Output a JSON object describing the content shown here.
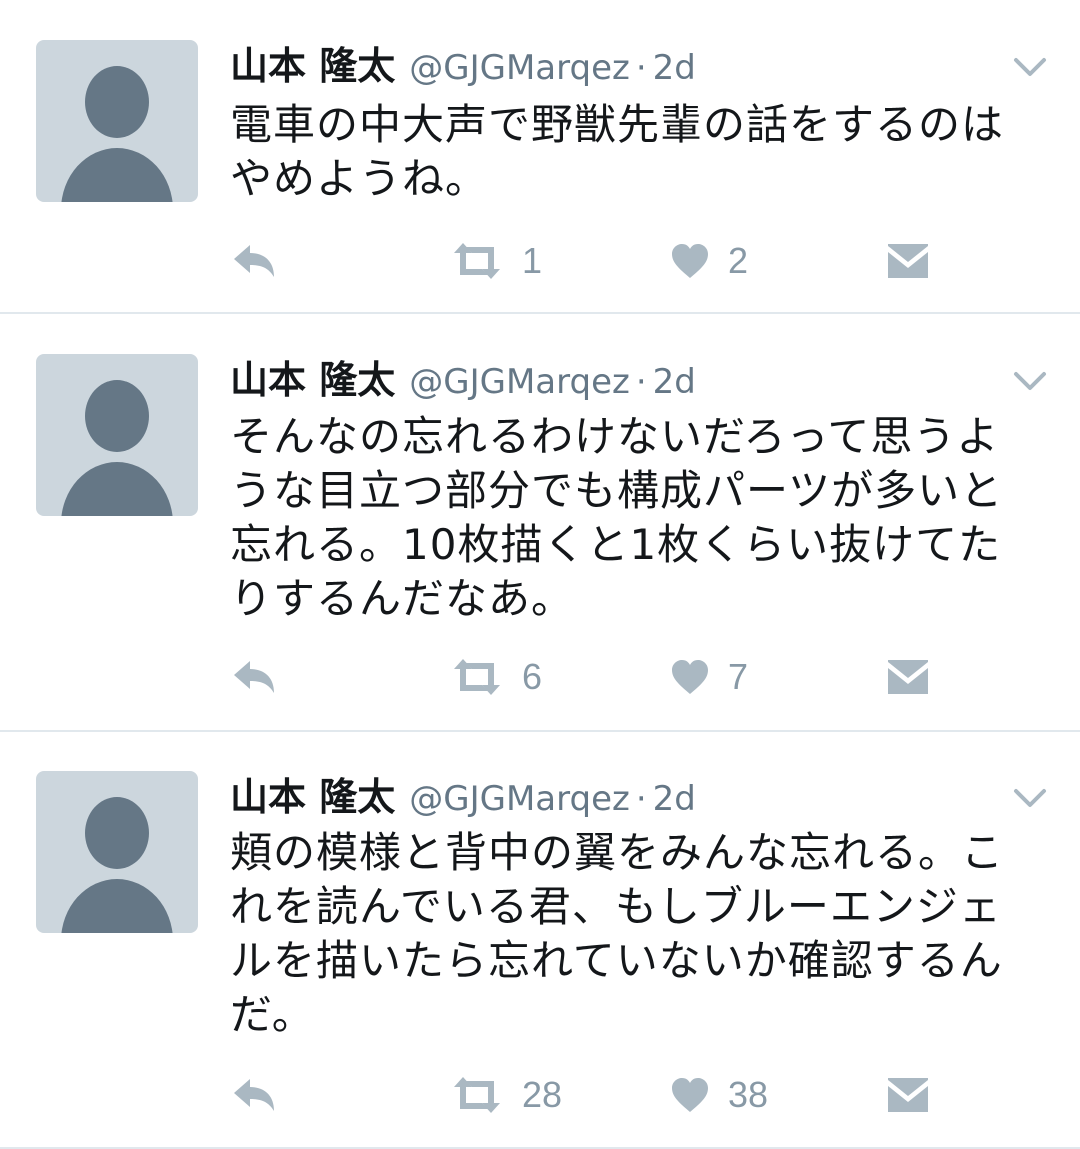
{
  "tweets": [
    {
      "name": "山本 隆太",
      "handle": "@GJGMarqez",
      "separator": "·",
      "time": "2d",
      "text": "電車の中大声で野獣先輩の話をするのは\nやめようね。",
      "retweets": "1",
      "likes": "2"
    },
    {
      "name": "山本 隆太",
      "handle": "@GJGMarqez",
      "separator": "·",
      "time": "2d",
      "text": "そんなの忘れるわけないだろって思うよ\nうな目立つ部分でも構成パーツが多いと\n忘れる。10枚描くと1枚くらい抜けてた\nりするんだなあ。",
      "retweets": "6",
      "likes": "7"
    },
    {
      "name": "山本 隆太",
      "handle": "@GJGMarqez",
      "separator": "·",
      "time": "2d",
      "text": "頬の模様と背中の翼をみんな忘れる。こ\nれを読んでいる君、もしブルーエンジェ\nルを描いたら忘れていないか確認するん\nだ。",
      "retweets": "28",
      "likes": "38"
    }
  ],
  "icons": {
    "avatar": "default-avatar-icon",
    "caret": "chevron-down-icon",
    "reply": "reply-icon",
    "retweet": "retweet-icon",
    "like": "heart-icon",
    "dm": "envelope-icon"
  },
  "colors": {
    "text": "#14171a",
    "secondary": "#657786",
    "icon": "#aab8c2",
    "avatar_bg": "#ccd6dd",
    "avatar_fg": "#657786",
    "divider": "#e1e8ed"
  }
}
